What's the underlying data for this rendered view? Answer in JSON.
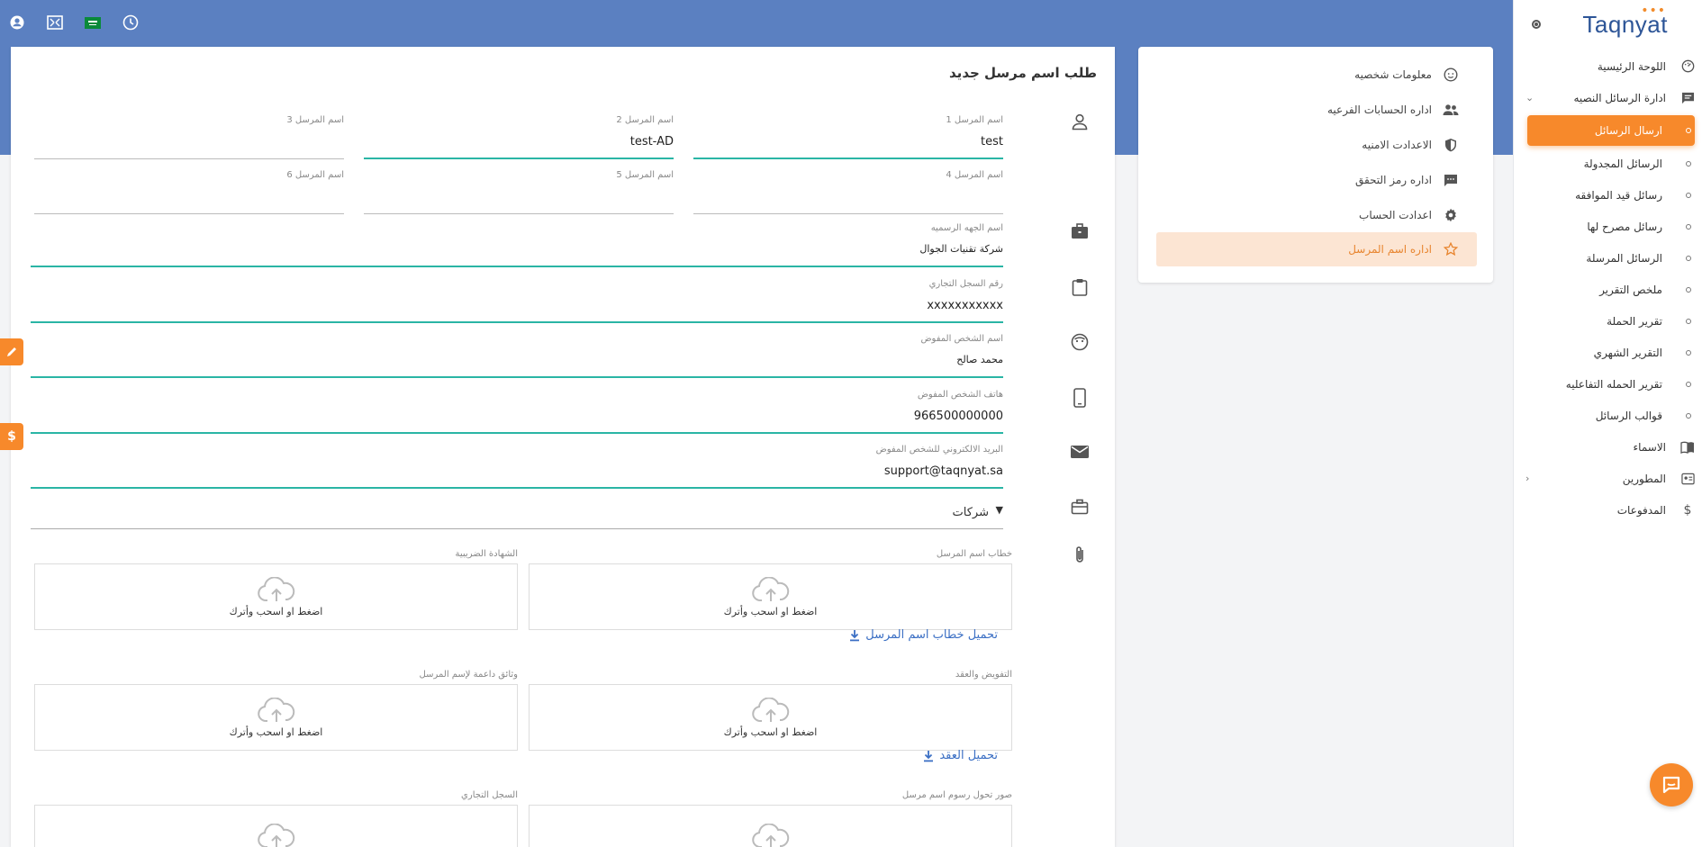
{
  "brand": {
    "name": "Taqnyat",
    "dots": "•••"
  },
  "topbar": {
    "icons": [
      "account-icon",
      "fullscreen-icon",
      "saudi-flag-icon",
      "clock-icon"
    ]
  },
  "sidebar": {
    "items": [
      {
        "label": "اللوحة الرئيسية",
        "icon": "dashboard-icon"
      },
      {
        "label": "ادارة الرسائل النصيه",
        "icon": "message-icon"
      }
    ],
    "sub_items": [
      {
        "label": "ارسال الرسائل"
      },
      {
        "label": "الرسائل المجدولة"
      },
      {
        "label": "رسائل قيد الموافقه"
      },
      {
        "label": "رسائل مصرح لها"
      },
      {
        "label": "الرسائل المرسلة"
      },
      {
        "label": "ملخص التقرير"
      },
      {
        "label": "تقرير الحملة"
      },
      {
        "label": "التقرير الشهري"
      },
      {
        "label": "تقرير الحمله التفاعليه"
      },
      {
        "label": "قوالب الرسائل"
      }
    ],
    "bottom_items": [
      {
        "label": "الاسماء",
        "icon": "book-icon"
      },
      {
        "label": "المطورين",
        "icon": "developers-icon"
      },
      {
        "label": "المدفوعات",
        "icon": "dollar-icon"
      }
    ]
  },
  "settings_menu": {
    "items": [
      {
        "label": "معلومات شخصيه",
        "icon": "face-icon"
      },
      {
        "label": "اداره الحسابات الفرعيه",
        "icon": "people-icon"
      },
      {
        "label": "الاعدادت الامنيه",
        "icon": "shield-icon"
      },
      {
        "label": "اداره رمز التحقق",
        "icon": "chat-icon"
      },
      {
        "label": "اعدادت الحساب",
        "icon": "gear-icon"
      },
      {
        "label": "اداره اسم المرسل",
        "icon": "star-icon"
      }
    ]
  },
  "form": {
    "title": "طلب اسم مرسل جديد",
    "sender_names": [
      {
        "label": "اسم المرسل 1",
        "value": "test"
      },
      {
        "label": "اسم المرسل 2",
        "value": "test-AD"
      },
      {
        "label": "اسم المرسل 3",
        "value": ""
      },
      {
        "label": "اسم المرسل 4",
        "value": ""
      },
      {
        "label": "اسم المرسل 5",
        "value": ""
      },
      {
        "label": "اسم المرسل 6",
        "value": ""
      }
    ],
    "official_name": {
      "label": "اسم الجهه الرسميه",
      "value": "شركة تقنيات الجوال"
    },
    "cr_number": {
      "label": "رقم السجل التجاري",
      "value": "xxxxxxxxxxx"
    },
    "authorized_name": {
      "label": "اسم الشخص المفوض",
      "value": "محمد صالح"
    },
    "authorized_phone": {
      "label": "هاتف الشخص المفوض",
      "value": "966500000000"
    },
    "authorized_email": {
      "label": "البريد الالكتروني للشخص المفوض",
      "value": "support@taqnyat.sa"
    },
    "entity_type": {
      "value": "شركات"
    },
    "uploads": [
      {
        "label": "خطاب اسم المرسل",
        "text": "اضغط او اسحب وأترك"
      },
      {
        "label": "الشهادة الضريبية",
        "text": "اضغط او اسحب وأترك"
      },
      {
        "label": "التفويض والعقد",
        "text": "اضغط او اسحب وأترك"
      },
      {
        "label": "وثائق داعمة لإسم المرسل",
        "text": "اضغط او اسحب وأترك"
      },
      {
        "label": "صور تحول رسوم اسم مرسل",
        "text": ""
      },
      {
        "label": "السجل التجاري",
        "text": ""
      }
    ],
    "download_letter": "تحميل خطاب اسم المرسل",
    "download_contract": "تحميل العقد"
  },
  "colors": {
    "header": "#5b80c1",
    "accent": "#f7892b",
    "input_active": "#2ab5a5",
    "link": "#3b6fc4"
  }
}
